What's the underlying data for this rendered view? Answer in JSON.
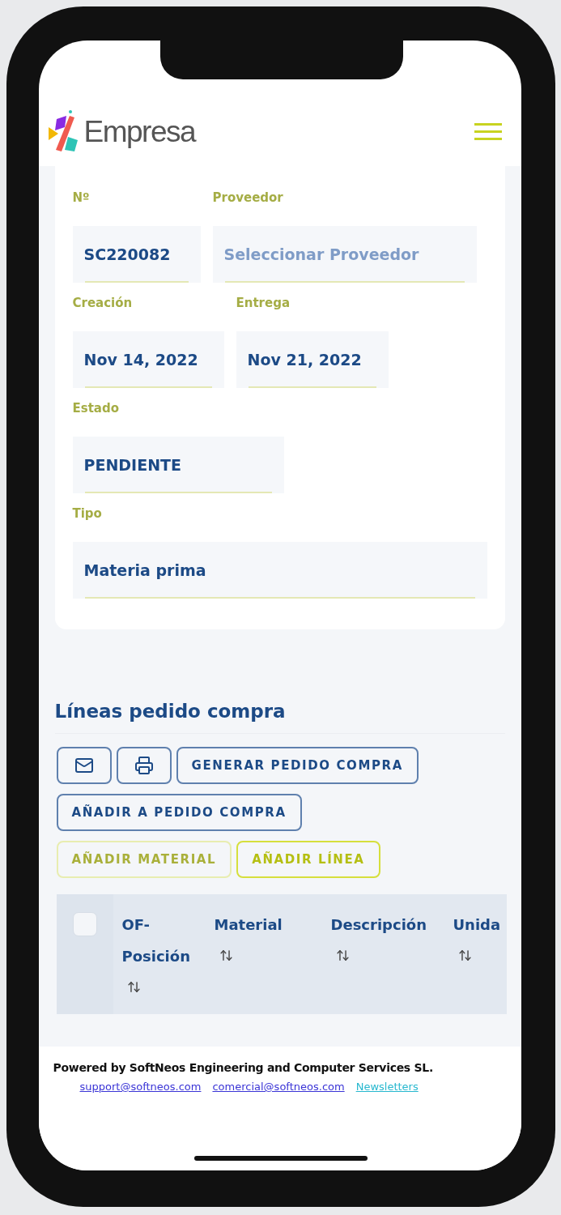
{
  "header": {
    "logo_text": "Empresa"
  },
  "form": {
    "rows": [
      {
        "fields": [
          {
            "label": "Nº",
            "value": "SC220082"
          },
          {
            "label": "Proveedor",
            "placeholder": "Seleccionar Proveedor"
          }
        ]
      },
      {
        "fields": [
          {
            "label": "Creación",
            "value": "Nov 14, 2022"
          },
          {
            "label": "Entrega",
            "value": "Nov 21, 2022"
          }
        ]
      },
      {
        "fields": [
          {
            "label": "Estado",
            "value": "PENDIENTE"
          }
        ]
      },
      {
        "fields": [
          {
            "label": "Tipo",
            "value": "Materia prima"
          }
        ]
      }
    ]
  },
  "lines": {
    "title": "Líneas pedido compra",
    "toolbar": [
      {
        "buttons": [
          {
            "kind": "email",
            "disabled": false
          },
          {
            "kind": "print",
            "disabled": false
          },
          {
            "kind": "primary",
            "label": "GENERAR PEDIDO COMPRA",
            "disabled": false
          }
        ]
      },
      {
        "buttons": [
          {
            "kind": "primary",
            "label": "AÑADIR A PEDIDO COMPRA",
            "disabled": false
          }
        ]
      },
      {
        "buttons": [
          {
            "kind": "accent",
            "label": "AÑADIR MATERIAL",
            "disabled": true
          },
          {
            "kind": "accent",
            "label": "AÑADIR LÍNEA",
            "disabled": false
          }
        ]
      }
    ],
    "table": {
      "select_all": {
        "checked": false
      },
      "columns": [
        {
          "label": "OF-Posición"
        },
        {
          "label": "Material"
        },
        {
          "label": "Descripción"
        },
        {
          "label": "Unida"
        }
      ]
    }
  },
  "footer": {
    "text": "Powered by SoftNeos Engineering and Computer Services SL.",
    "links": [
      {
        "label": "support@softneos.com",
        "kind": "email"
      },
      {
        "label": "comercial@softneos.com",
        "kind": "email"
      },
      {
        "label": "Newsletters",
        "kind": "page"
      }
    ]
  }
}
